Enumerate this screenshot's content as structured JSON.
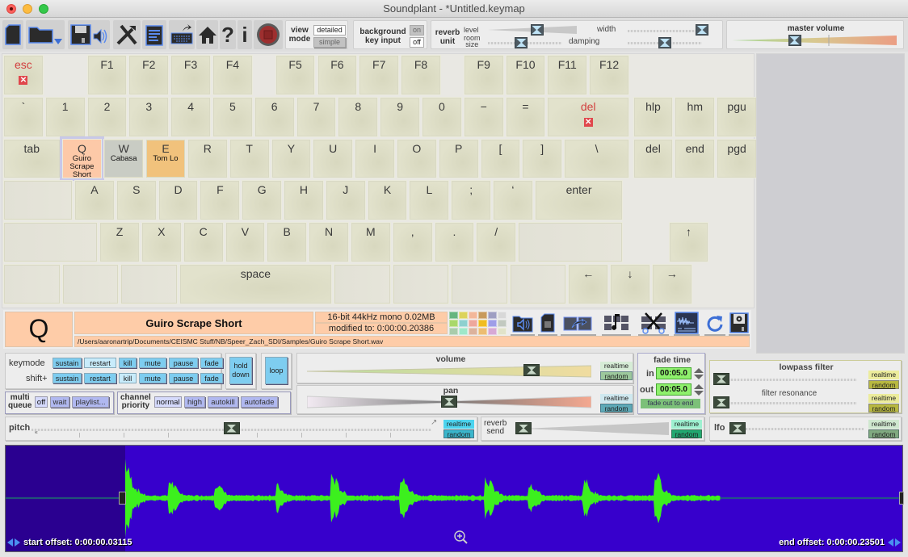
{
  "window": {
    "title": "Soundplant - *Untitled.keymap"
  },
  "toolbar": {
    "icons": [
      "new-file-icon",
      "open-folder-icon",
      "save-icon",
      "export-sound-icon",
      "tools-icon",
      "notes-icon",
      "keyboard-export-icon",
      "home-icon",
      "help-icon",
      "info-icon",
      "record-icon"
    ],
    "view_mode": {
      "label_top": "view",
      "label_bottom": "mode",
      "detailed": "detailed",
      "simple": "simple",
      "selected": "detailed"
    },
    "background_key_input": {
      "label_top": "background",
      "label_bottom": "key input",
      "on": "on",
      "off": "off",
      "selected": "off"
    },
    "reverb_unit": {
      "label_top": "reverb",
      "label_bottom": "unit",
      "level": "level",
      "room_size_top": "room",
      "room_size_bottom": "size",
      "width": "width",
      "damping": "damping",
      "level_value": 0.55,
      "room_size_value": 0.45,
      "width_value": 1.0,
      "damping_value": 0.5
    },
    "master_volume": {
      "label": "master volume",
      "value": 0.38
    }
  },
  "keyboard": {
    "rows": [
      [
        {
          "label": "esc",
          "color": "red",
          "mark": "x"
        },
        {
          "label": "F1"
        },
        {
          "label": "F2"
        },
        {
          "label": "F3"
        },
        {
          "label": "F4"
        },
        {
          "label": "F5"
        },
        {
          "label": "F6"
        },
        {
          "label": "F7"
        },
        {
          "label": "F8"
        },
        {
          "label": "F9"
        },
        {
          "label": "F10"
        },
        {
          "label": "F11"
        },
        {
          "label": "F12"
        }
      ],
      [
        {
          "label": "`"
        },
        {
          "label": "1"
        },
        {
          "label": "2"
        },
        {
          "label": "3"
        },
        {
          "label": "4"
        },
        {
          "label": "5"
        },
        {
          "label": "6"
        },
        {
          "label": "7"
        },
        {
          "label": "8"
        },
        {
          "label": "9"
        },
        {
          "label": "0"
        },
        {
          "label": "−"
        },
        {
          "label": "="
        },
        {
          "label": "del",
          "color": "red",
          "mark": "x"
        },
        {
          "label": "hlp"
        },
        {
          "label": "hm"
        },
        {
          "label": "pgu"
        }
      ],
      [
        {
          "label": "tab"
        },
        {
          "label": "Q",
          "sample": "Guiro Scrape Short"
        },
        {
          "label": "W",
          "sample": "Cabasa"
        },
        {
          "label": "E",
          "sample": "Tom Lo"
        },
        {
          "label": "R"
        },
        {
          "label": "T"
        },
        {
          "label": "Y"
        },
        {
          "label": "U"
        },
        {
          "label": "I"
        },
        {
          "label": "O"
        },
        {
          "label": "P"
        },
        {
          "label": "["
        },
        {
          "label": "]"
        },
        {
          "label": "\\"
        },
        {
          "label": "del"
        },
        {
          "label": "end"
        },
        {
          "label": "pgd"
        }
      ],
      [
        {
          "label": ""
        },
        {
          "label": "A"
        },
        {
          "label": "S"
        },
        {
          "label": "D"
        },
        {
          "label": "F"
        },
        {
          "label": "G"
        },
        {
          "label": "H"
        },
        {
          "label": "J"
        },
        {
          "label": "K"
        },
        {
          "label": "L"
        },
        {
          "label": ";"
        },
        {
          "label": "‘"
        },
        {
          "label": "enter"
        }
      ],
      [
        {
          "label": ""
        },
        {
          "label": "Z"
        },
        {
          "label": "X"
        },
        {
          "label": "C"
        },
        {
          "label": "V"
        },
        {
          "label": "B"
        },
        {
          "label": "N"
        },
        {
          "label": "M"
        },
        {
          "label": ","
        },
        {
          "label": "."
        },
        {
          "label": "/"
        },
        {
          "label": ""
        },
        {
          "label": "↑"
        }
      ],
      [
        {
          "label": ""
        },
        {
          "label": ""
        },
        {
          "label": ""
        },
        {
          "label": "space"
        },
        {
          "label": ""
        },
        {
          "label": ""
        },
        {
          "label": ""
        },
        {
          "label": ""
        },
        {
          "label": "←"
        },
        {
          "label": "↓"
        },
        {
          "label": "→"
        }
      ]
    ],
    "colors": {
      "Q": "#fdc9a8",
      "W": "#c9ccc4",
      "E": "#f1c27c"
    }
  },
  "sample": {
    "key": "Q",
    "name": "Guiro Scrape Short",
    "format": "16-bit 44kHz mono 0.02MB",
    "modified": "modified to: 0:00:00.20386",
    "path": "/Users/aaronartrip/Documents/CEISMC Stuff/NB/Speer_Zach_SDI/Samples/Guiro Scrape Short.wav",
    "palette": [
      "#67b57f",
      "#dcd35a",
      "#f3b79a",
      "#c89a5c",
      "#9e9ec2",
      "#d8d8d8",
      "#a9d86a",
      "#8ed0cf",
      "#eea79c",
      "#f0bd22",
      "#9f9ee8",
      "#c2c9c0",
      "#a9ccab",
      "#9ee8c9",
      "#dcb29c",
      "#ecbd72",
      "#d7a9d5",
      "#e1e3c9"
    ],
    "tool_icons": [
      "load-sound-icon",
      "blank-file-icon",
      "replace-icon",
      "music-note-icon",
      "cut-icon",
      "waveform-editor-icon",
      "reload-icon",
      "save-settings-icon"
    ]
  },
  "controls": {
    "keymode": {
      "label": "keymode",
      "shift_label": "shift+",
      "options": [
        "sustain",
        "restart",
        "kill",
        "mute",
        "pause",
        "fade"
      ],
      "selected": "restart",
      "shift_selected": "kill"
    },
    "hold_down": {
      "line1": "hold",
      "line2": "down"
    },
    "loop": "loop",
    "multi_queue": {
      "line1": "multi",
      "line2": "queue",
      "options": [
        "off",
        "wait",
        "playlist..."
      ],
      "selected": "off"
    },
    "channel_priority": {
      "line1": "channel",
      "line2": "priority",
      "options": [
        "normal",
        "high",
        "autokill",
        "autofade"
      ],
      "selected": "normal"
    },
    "volume": {
      "label": "volume",
      "value": 0.79,
      "realtime": "realtime",
      "random": "random"
    },
    "pan": {
      "label": "pan",
      "value": 0.5,
      "realtime": "realtime",
      "random": "random"
    },
    "fade_time": {
      "label": "fade time",
      "in_label": "in",
      "in_value": "00:05.0",
      "out_label": "out",
      "out_value": "00:05.0",
      "fade_out_to_end": "fade out to end"
    },
    "lowpass_filter": {
      "label": "lowpass filter",
      "value": 0.0,
      "realtime": "realtime",
      "random": "random"
    },
    "filter_resonance": {
      "label": "filter resonance",
      "value": 0.0,
      "realtime": "realtime",
      "random": "random"
    },
    "pitch": {
      "label": "pitch",
      "value": 0.5,
      "realtime": "realtime",
      "random": "random"
    },
    "reverb_send": {
      "line1": "reverb",
      "line2": "send",
      "value": 0.0,
      "realtime": "realtime",
      "random": "random"
    },
    "lfo": {
      "label": "lfo",
      "value": 0.0,
      "realtime": "realtime",
      "random": "random"
    }
  },
  "waveform": {
    "start_offset": "start offset: 0:00:00.03115",
    "end_offset": "end offset: 0:00:00.23501",
    "zoom_icon": "zoom-in-icon"
  }
}
